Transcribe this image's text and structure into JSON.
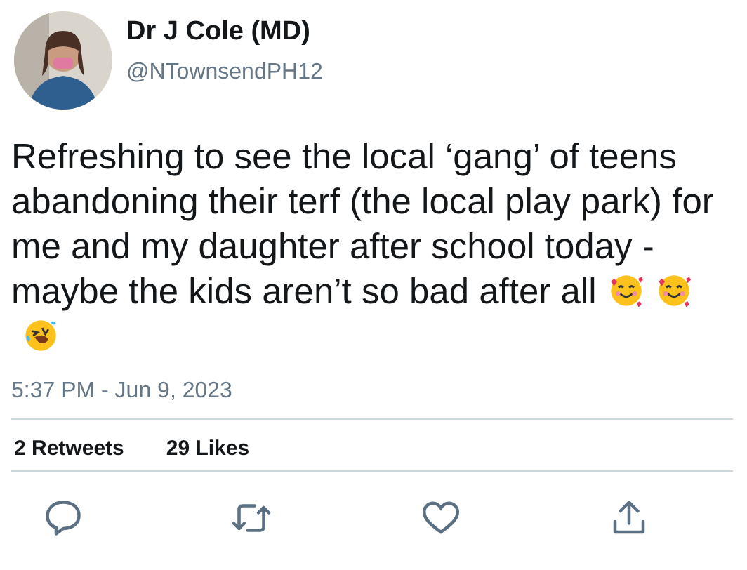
{
  "author": {
    "name": "Dr J Cole (MD)",
    "handle": "@NTownsendPH12"
  },
  "tweet": {
    "text": "Refreshing to see the local ‘gang’ of teens abandoning their terf (the local play park) for me and my daughter after school today - maybe the kids aren’t so bad after all",
    "emojis": [
      {
        "kind": "smiling-hearts"
      },
      {
        "kind": "smiling-hearts"
      },
      {
        "kind": "laughing-tears"
      }
    ]
  },
  "timestamp": "5:37 PM - Jun 9, 2023",
  "stats": [
    "2 Retweets",
    "29 Likes"
  ],
  "actions": [
    {
      "kind": "reply"
    },
    {
      "kind": "retweet"
    },
    {
      "kind": "like"
    },
    {
      "kind": "share"
    }
  ]
}
